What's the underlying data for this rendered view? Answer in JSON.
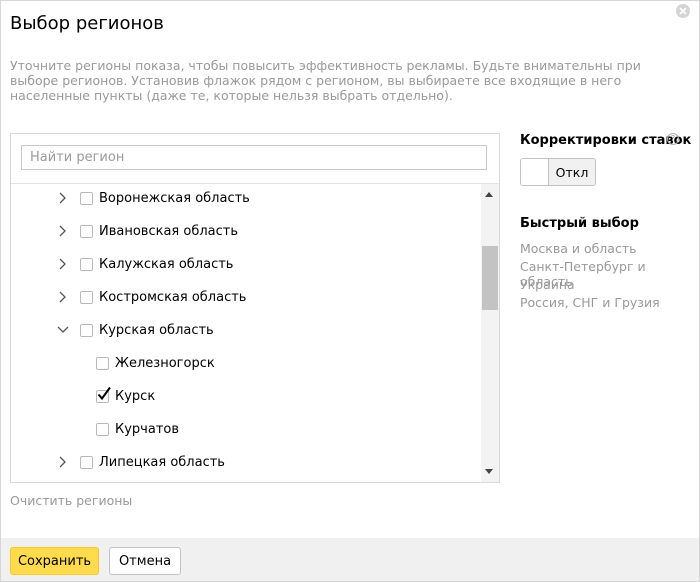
{
  "dialog": {
    "title": "Выбор регионов",
    "description": "Уточните регионы показа, чтобы повысить эффективность рекламы. Будьте внимательны при выборе регионов. Установив флажок рядом с регионом, вы выбираете все входящие в него населенные пункты (даже те, которые нельзя выбрать отдельно)."
  },
  "search": {
    "placeholder": "Найти регион",
    "value": ""
  },
  "tree": {
    "items": [
      {
        "label": "Воронежская область",
        "level": 0,
        "expanded": false,
        "checked": false
      },
      {
        "label": "Ивановская область",
        "level": 0,
        "expanded": false,
        "checked": false
      },
      {
        "label": "Калужская область",
        "level": 0,
        "expanded": false,
        "checked": false
      },
      {
        "label": "Костромская область",
        "level": 0,
        "expanded": false,
        "checked": false
      },
      {
        "label": "Курская область",
        "level": 0,
        "expanded": true,
        "checked": false
      },
      {
        "label": "Железногорск",
        "level": 1,
        "checked": false
      },
      {
        "label": "Курск",
        "level": 1,
        "checked": true
      },
      {
        "label": "Курчатов",
        "level": 1,
        "checked": false
      },
      {
        "label": "Липецкая область",
        "level": 0,
        "expanded": false,
        "checked": false
      }
    ]
  },
  "clear_regions": "Очистить регионы",
  "bid_adjustments": {
    "title": "Корректировки ставок",
    "help_label": "?",
    "toggle_label": "Откл",
    "toggle_state": "off"
  },
  "quick_select": {
    "title": "Быстрый выбор",
    "items": [
      "Москва и область",
      "Санкт-Петербург и область",
      "Украина",
      "Россия, СНГ и Грузия"
    ]
  },
  "footer": {
    "save_label": "Сохранить",
    "cancel_label": "Отмена"
  },
  "colors": {
    "accent": "#ffdb4d",
    "muted_text": "#999999",
    "check": "#000000"
  }
}
